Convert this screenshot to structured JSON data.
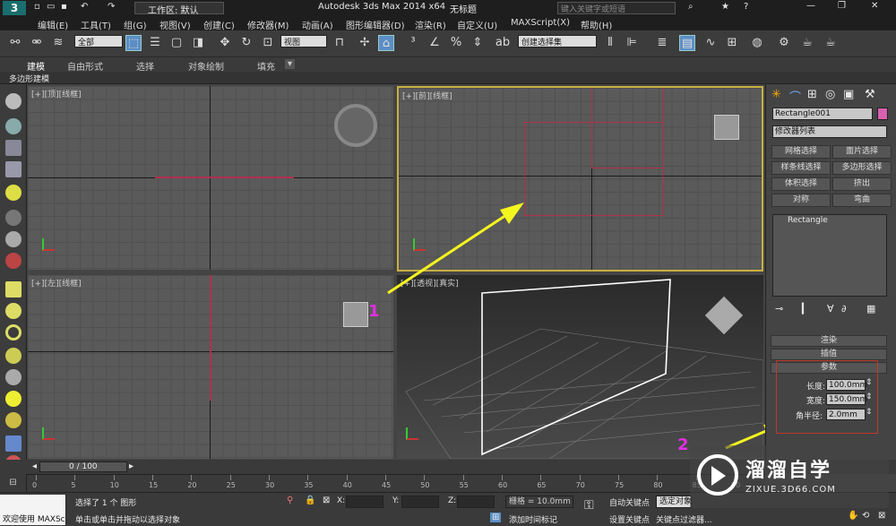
{
  "window": {
    "workspace": "工作区: 默认",
    "title": "Autodesk 3ds Max  2014 x64",
    "doc": "无标题",
    "search_placeholder": "键入关键字或短语"
  },
  "menu": [
    "编辑(E)",
    "工具(T)",
    "组(G)",
    "视图(V)",
    "创建(C)",
    "修改器(M)",
    "动画(A)",
    "图形编辑器(D)",
    "渲染(R)",
    "自定义(U)",
    "MAXScript(X)",
    "帮助(H)"
  ],
  "toolbar": {
    "filter": "全部",
    "view": "视图",
    "selection_set": "创建选择集"
  },
  "ribbon": {
    "tabs": [
      "建模",
      "自由形式",
      "选择",
      "对象绘制",
      "填充"
    ],
    "sub": "多边形建模"
  },
  "viewports": {
    "top": "[+][顶][线框]",
    "front": "[+][前][线框]",
    "left": "[+][左][线框]",
    "persp": "[+][透视][真实]"
  },
  "annotations": {
    "marker1": "1",
    "marker2": "2"
  },
  "command_panel": {
    "object_name": "Rectangle001",
    "modifier_list": "修改器列表",
    "buttons": [
      "网格选择",
      "面片选择",
      "样条线选择",
      "多边形选择",
      "体积选择",
      "挤出",
      "对称",
      "弯曲"
    ],
    "stack_item": "Rectangle",
    "rollouts": [
      "渲染",
      "插值",
      "参数"
    ],
    "params": [
      {
        "label": "长度:",
        "value": "100.0mm"
      },
      {
        "label": "宽度:",
        "value": "150.0mm"
      },
      {
        "label": "角半径:",
        "value": "2.0mm"
      }
    ]
  },
  "timeline": {
    "frame": "0 / 100",
    "ticks": [
      "0",
      "5",
      "10",
      "15",
      "20",
      "25",
      "30",
      "35",
      "40",
      "45",
      "50",
      "55",
      "60",
      "65",
      "70",
      "75",
      "80",
      "85",
      "90"
    ]
  },
  "status": {
    "welcome": "欢迎使用 MAXSc",
    "selected": "选择了 1 个 图形",
    "hint": "单击或单击并拖动以选择对象",
    "x_label": "X:",
    "y_label": "Y:",
    "z_label": "Z:",
    "grid": "栅格 = 10.0mm",
    "add_time_tag": "添加时间标记",
    "auto_key": "自动关键点",
    "set_key": "设置关键点",
    "selected_obj": "选定对象",
    "key_filter": "关键点过滤器..."
  },
  "watermark": {
    "brand": "溜溜自学",
    "url": "ZIXUE.3D66.COM"
  },
  "colors": {
    "accent": "#4a90d9",
    "spline": "#b0304a",
    "annotation_box": "#c0392b",
    "arrow": "#f5f520",
    "marker": "#e030e0",
    "swatch": "#d860b0"
  }
}
